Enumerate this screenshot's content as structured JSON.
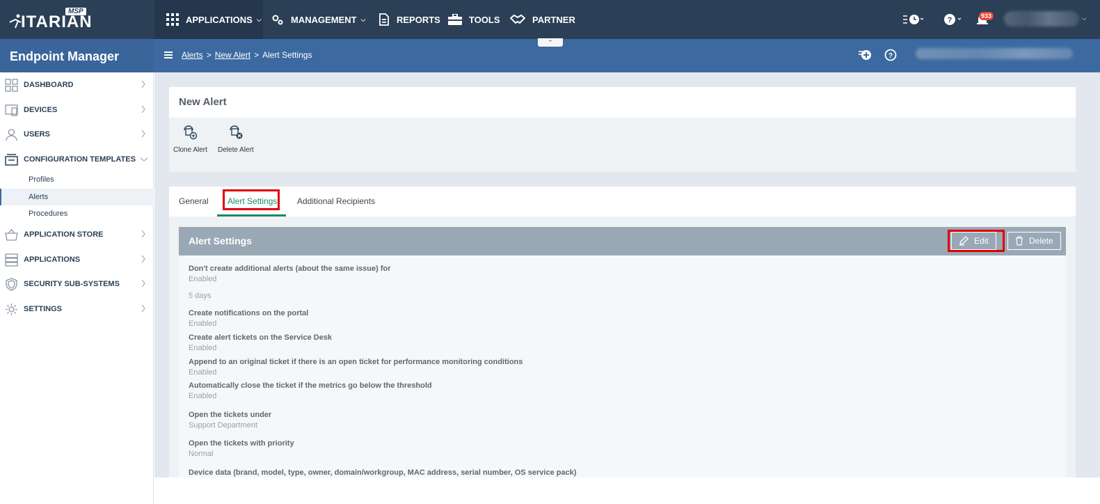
{
  "topnav": {
    "logo": "ITARIAN",
    "logo_badge": "MSP",
    "items": {
      "applications": "APPLICATIONS",
      "management": "MANAGEMENT",
      "reports": "REPORTS",
      "tools": "TOOLS",
      "partner": "PARTNER"
    },
    "notification_count": "933"
  },
  "subbar": {
    "app_title": "Endpoint Manager",
    "breadcrumb": [
      "Alerts",
      "New Alert",
      "Alert Settings"
    ]
  },
  "sidebar": {
    "items": [
      {
        "label": "DASHBOARD"
      },
      {
        "label": "DEVICES"
      },
      {
        "label": "USERS"
      },
      {
        "label": "CONFIGURATION TEMPLATES"
      },
      {
        "label": "APPLICATION STORE"
      },
      {
        "label": "APPLICATIONS"
      },
      {
        "label": "SECURITY SUB-SYSTEMS"
      },
      {
        "label": "SETTINGS"
      }
    ],
    "sub_items": [
      {
        "label": "Profiles"
      },
      {
        "label": "Alerts"
      },
      {
        "label": "Procedures"
      }
    ]
  },
  "page": {
    "title": "New Alert",
    "tools": {
      "clone": "Clone Alert",
      "delete": "Delete Alert"
    },
    "tabs": [
      "General",
      "Alert Settings",
      "Additional Recipients"
    ],
    "panel": {
      "title": "Alert Settings",
      "edit": "Edit",
      "delete": "Delete"
    },
    "settings": [
      {
        "label": "Don't create additional alerts (about the same issue) for",
        "value": "Enabled",
        "extra": "5 days"
      },
      {
        "label": "Create notifications on the portal",
        "value": "Enabled"
      },
      {
        "label": "Create alert tickets on the Service Desk",
        "value": "Enabled"
      },
      {
        "label": "Append to an original ticket if there is an open ticket for performance monitoring conditions",
        "value": "Enabled"
      },
      {
        "label": "Automatically close the ticket if the metrics go below the threshold",
        "value": "Enabled"
      },
      {
        "label": "Open the tickets under",
        "value": "Support Department"
      },
      {
        "label": "Open the tickets with priority",
        "value": "Normal"
      },
      {
        "label": "Device data (brand, model, type, owner, domain/workgroup, MAC address, serial number, OS service pack)"
      }
    ]
  }
}
